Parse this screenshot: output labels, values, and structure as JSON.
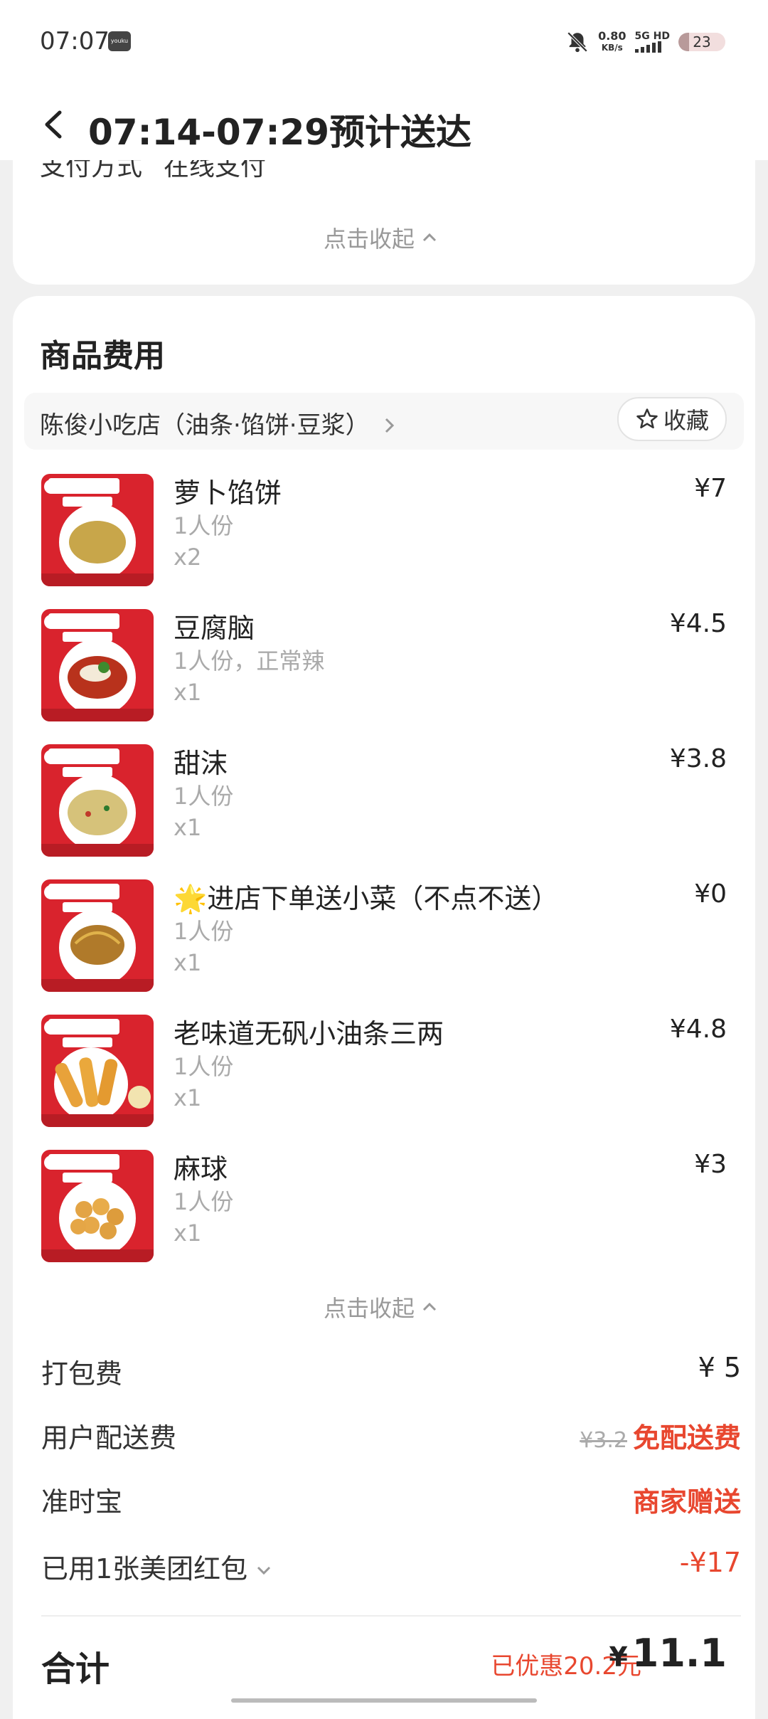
{
  "status": {
    "time": "07:07",
    "app_badge": "youku",
    "net_speed": "0.80",
    "net_unit": "KB/s",
    "signal_label": "5G HD",
    "battery": "23",
    "battery_level": 0.23
  },
  "header": {
    "title": "07:14-07:29预计送达"
  },
  "payment": {
    "label": "支付方式",
    "value": "在线支付",
    "collapse": "点击收起"
  },
  "goods": {
    "section_title": "商品费用",
    "shop_name": "陈俊小吃店（油条·馅饼·豆浆）",
    "favorite": "收藏",
    "items": [
      {
        "name": "萝卜馅饼",
        "spec": "1人份",
        "qty": "x2",
        "price": "¥7"
      },
      {
        "name": "豆腐脑",
        "spec": "1人份，正常辣",
        "qty": "x1",
        "price": "¥4.5"
      },
      {
        "name": "甜沫",
        "spec": "1人份",
        "qty": "x1",
        "price": "¥3.8"
      },
      {
        "name": "🌟进店下单送小菜（不点不送）",
        "spec": "1人份",
        "qty": "x1",
        "price": "¥0"
      },
      {
        "name": "老味道无矾小油条三两",
        "spec": "1人份",
        "qty": "x1",
        "price": "¥4.8"
      },
      {
        "name": "麻球",
        "spec": "1人份",
        "qty": "x1",
        "price": "¥3"
      }
    ],
    "collapse": "点击收起"
  },
  "fees": {
    "packing": {
      "label": "打包费",
      "value": "¥ 5"
    },
    "delivery": {
      "label": "用户配送费",
      "original": "¥3.2",
      "value": "免配送费"
    },
    "ontime": {
      "label": "准时宝",
      "value": "商家赠送"
    },
    "coupon": {
      "label": "已用1张美团红包",
      "value": "-¥17"
    }
  },
  "total": {
    "label": "合计",
    "saved": "已优惠20.2元",
    "currency": "¥",
    "amount": "11.1"
  },
  "colors": {
    "accent_red": "#e8472f",
    "muted": "#aaaaaa"
  }
}
